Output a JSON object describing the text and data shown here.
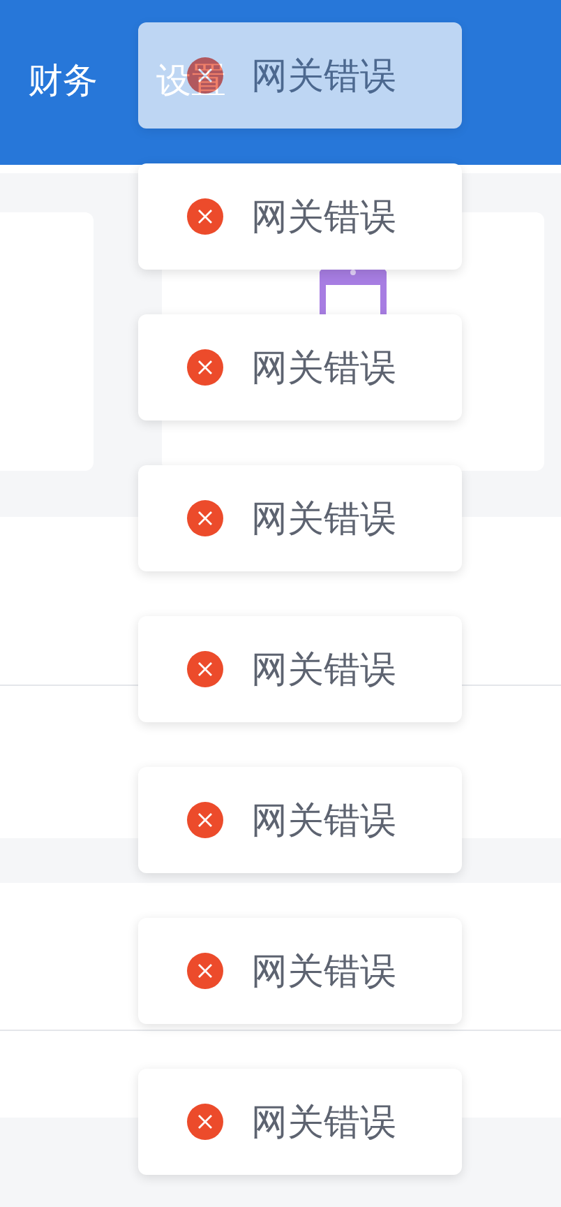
{
  "header": {
    "tabs": [
      {
        "label": "财务"
      },
      {
        "label": "设置"
      }
    ]
  },
  "toasts": [
    {
      "kind": "error",
      "message": "网关错误",
      "fading": true
    },
    {
      "kind": "error",
      "message": "网关错误",
      "fading": false
    },
    {
      "kind": "error",
      "message": "网关错误",
      "fading": false
    },
    {
      "kind": "error",
      "message": "网关错误",
      "fading": false
    },
    {
      "kind": "error",
      "message": "网关错误",
      "fading": false
    },
    {
      "kind": "error",
      "message": "网关错误",
      "fading": false
    },
    {
      "kind": "error",
      "message": "网关错误",
      "fading": false
    },
    {
      "kind": "error",
      "message": "网关错误",
      "fading": false
    }
  ]
}
